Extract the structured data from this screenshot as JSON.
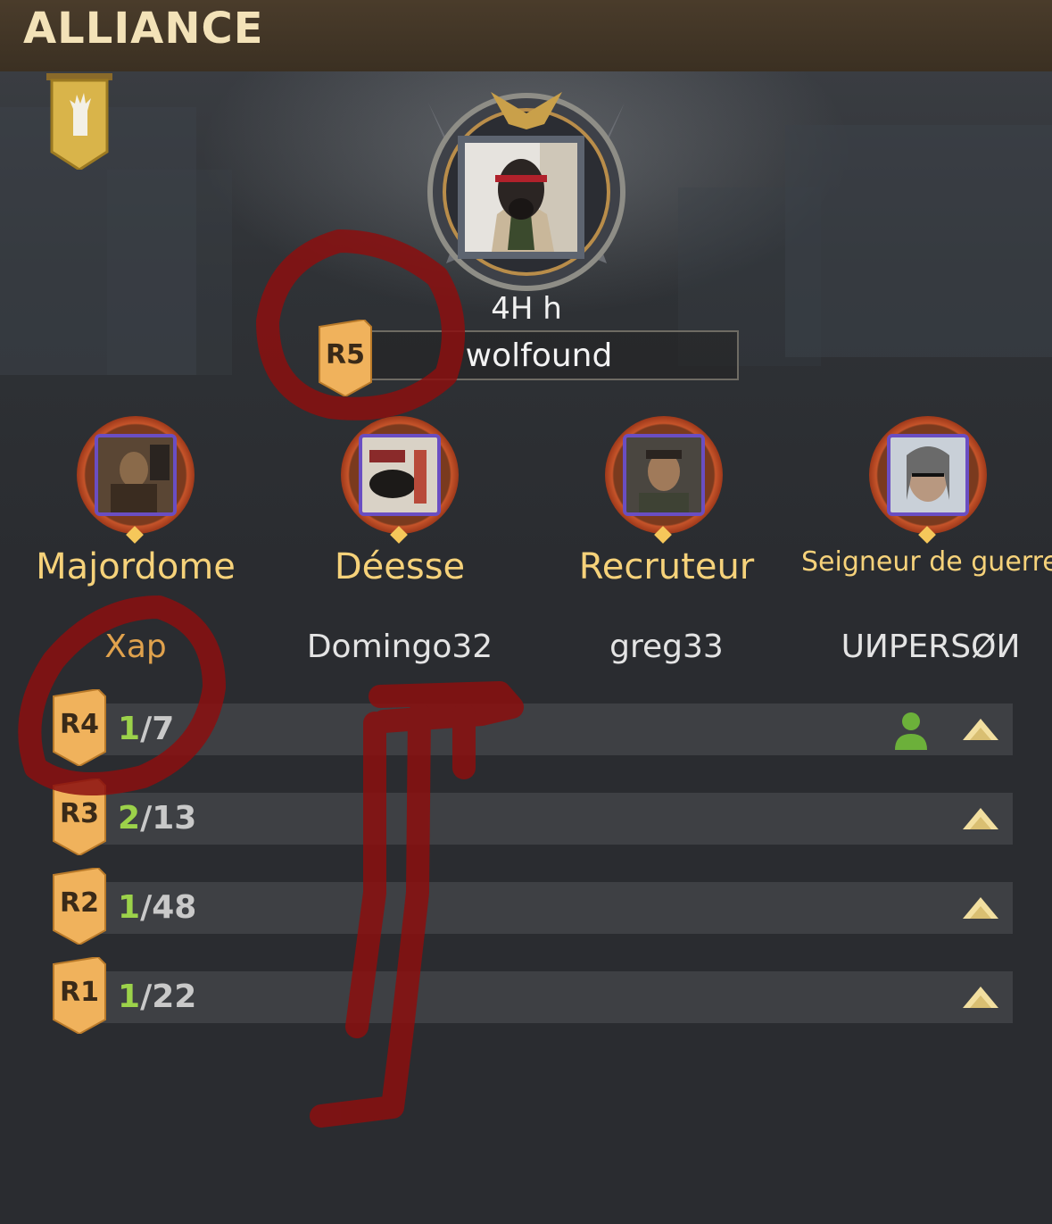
{
  "header": {
    "title": "ALLIANCE"
  },
  "leader": {
    "level": "4H h",
    "rank": "R5",
    "name": "wolfound"
  },
  "officers": [
    {
      "role": "Majordome",
      "member": "Xap"
    },
    {
      "role": "Déesse",
      "member": "Domingo32"
    },
    {
      "role": "Recruteur",
      "member": "greg33"
    },
    {
      "role": "Seigneur de guerre",
      "member": "UИPERSØИ"
    }
  ],
  "ranks": [
    {
      "rank": "R4",
      "current": "1",
      "total": "/7"
    },
    {
      "rank": "R3",
      "current": "2",
      "total": "/13"
    },
    {
      "rank": "R2",
      "current": "1",
      "total": "/48"
    },
    {
      "rank": "R1",
      "current": "1",
      "total": "/22"
    }
  ],
  "icons": {
    "banner": "alliance-banner-icon",
    "rank_row_online": "person-icon",
    "expand": "triangle-up-icon"
  },
  "colors": {
    "accent_gold": "#f6d27a",
    "count_green": "#9cd24a",
    "member_highlight": "#e0a24d",
    "annotation_red": "#8b0f0f"
  }
}
